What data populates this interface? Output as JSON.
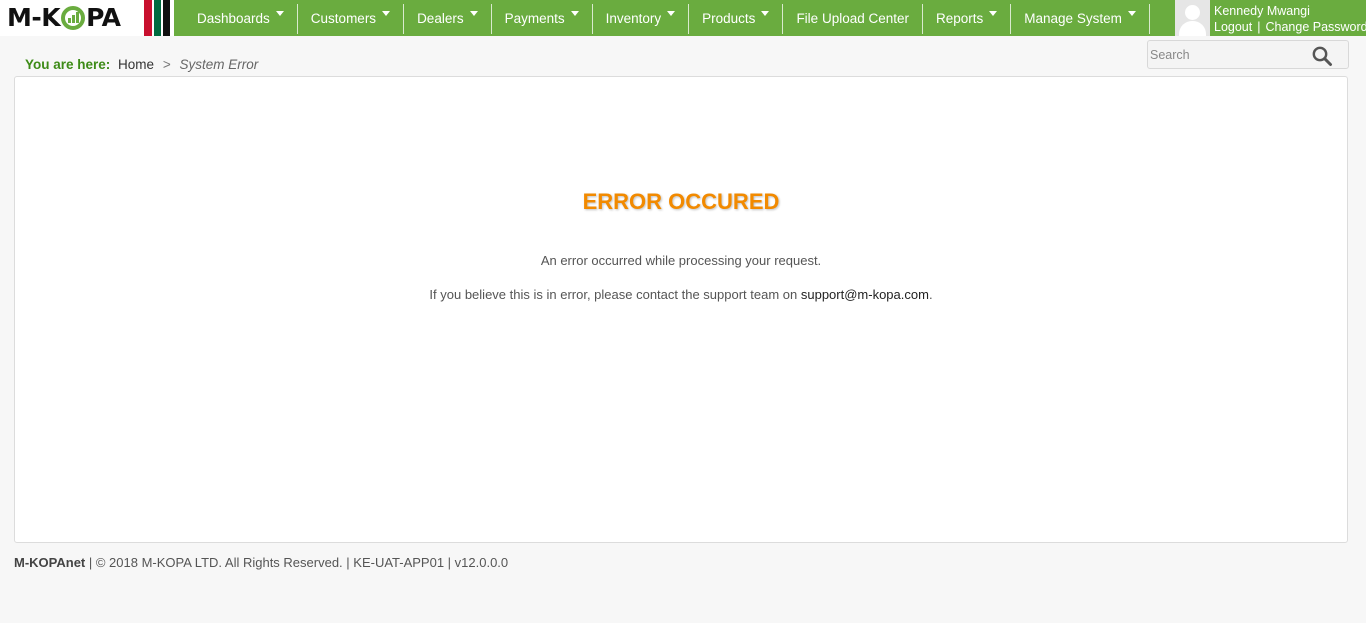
{
  "brand": {
    "logo_text_left": "M-K",
    "logo_text_right": "PA",
    "colors": {
      "primary_green": "#6aac3f",
      "flag_red": "#c8102e",
      "flag_green": "#006b3f",
      "flag_black": "#111111",
      "error_orange": "#f28a00"
    }
  },
  "nav": {
    "items": [
      {
        "label": "Dashboards",
        "has_dropdown": true
      },
      {
        "label": "Customers",
        "has_dropdown": true
      },
      {
        "label": "Dealers",
        "has_dropdown": true
      },
      {
        "label": "Payments",
        "has_dropdown": true
      },
      {
        "label": "Inventory",
        "has_dropdown": true
      },
      {
        "label": "Products",
        "has_dropdown": true
      },
      {
        "label": "File Upload Center",
        "has_dropdown": false
      },
      {
        "label": "Reports",
        "has_dropdown": true
      },
      {
        "label": "Manage System",
        "has_dropdown": true
      }
    ],
    "dropdown_icon": "caret-down-icon"
  },
  "user": {
    "name": "Kennedy Mwangi",
    "logout_label": "Logout",
    "separator": "|",
    "change_password_label": "Change Password",
    "avatar_icon": "user-silhouette-icon"
  },
  "search": {
    "placeholder": "Search",
    "value": "",
    "icon": "search-icon"
  },
  "breadcrumb": {
    "label": "You are here:",
    "home": "Home",
    "separator": ">",
    "current": "System Error"
  },
  "error": {
    "title": "ERROR OCCURED",
    "message": "An error occurred while processing your request.",
    "contact_prefix": "If you believe this is in error, please contact the support team on ",
    "support_email": "support@m-kopa.com",
    "contact_suffix": "."
  },
  "footer": {
    "brand": "M-KOPAnet",
    "text": " | © 2018 M-KOPA LTD. All Rights Reserved. | KE-UAT-APP01 | v12.0.0.0"
  }
}
